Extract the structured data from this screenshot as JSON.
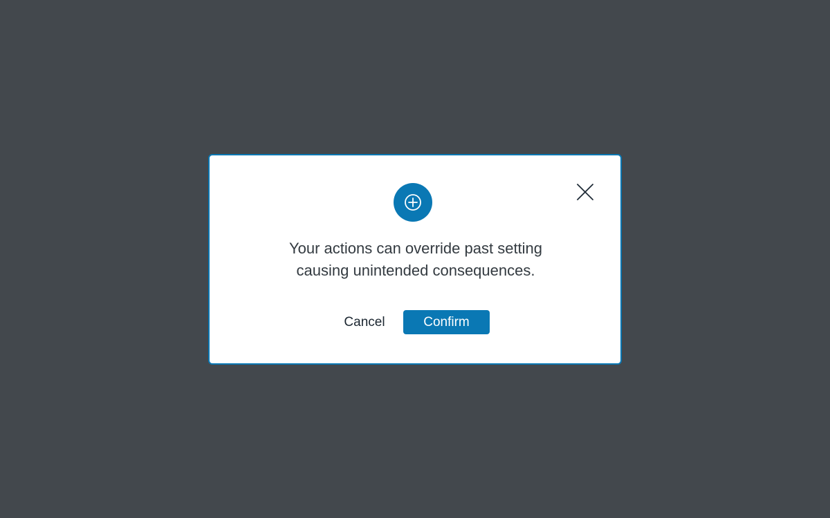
{
  "dialog": {
    "icon": "plus-circle-icon",
    "close_icon": "close-icon",
    "message_line1": "Your actions can override past setting",
    "message_line2": "causing unintended consequences.",
    "cancel_label": "Cancel",
    "confirm_label": "Confirm"
  },
  "colors": {
    "backdrop": "#43484d",
    "accent": "#0a78b4",
    "text": "#333a40",
    "dialog_background": "#ffffff"
  }
}
